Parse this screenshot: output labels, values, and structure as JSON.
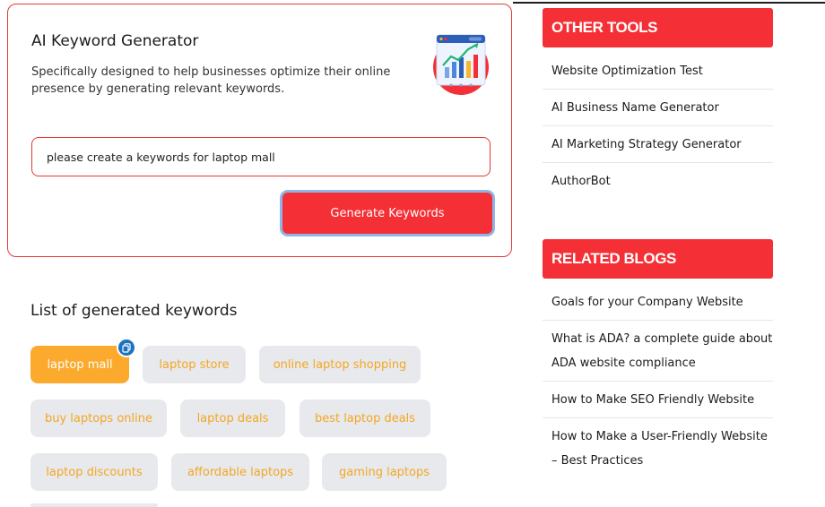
{
  "generator": {
    "title": "AI Keyword Generator",
    "description": "Specifically designed to help businesses optimize their online presence by generating relevant keywords.",
    "illustration_icon": "analytics-chart-icon",
    "input_value": "please create a keywords for laptop mall",
    "button_label": "Generate Keywords"
  },
  "keywords": {
    "heading": "List of generated keywords",
    "items": [
      "laptop mall",
      "laptop store",
      "online laptop shopping",
      "buy laptops online",
      "laptop deals",
      "best laptop deals",
      "laptop discounts",
      "affordable laptops",
      "gaming laptops"
    ],
    "active_index": 0,
    "copy_icon": "copy-icon"
  },
  "sidebar": {
    "other_tools": {
      "title": "OTHER TOOLS",
      "items": [
        "Website Optimization Test",
        "AI Business Name Generator",
        "AI Marketing Strategy Generator",
        "AuthorBot"
      ]
    },
    "related_blogs": {
      "title": "RELATED BLOGS",
      "items": [
        "Goals for your Company Website",
        "What is ADA? a complete guide about ADA website compliance",
        "How to Make SEO Friendly Website",
        "How to Make a User-Friendly Website – Best Practices"
      ]
    }
  },
  "colors": {
    "accent_red": "#f42f35",
    "chip_active": "#fbaa2d",
    "chip_text": "#f5a623",
    "chip_bg": "#e7e9ec",
    "badge_blue": "#1e73be"
  }
}
